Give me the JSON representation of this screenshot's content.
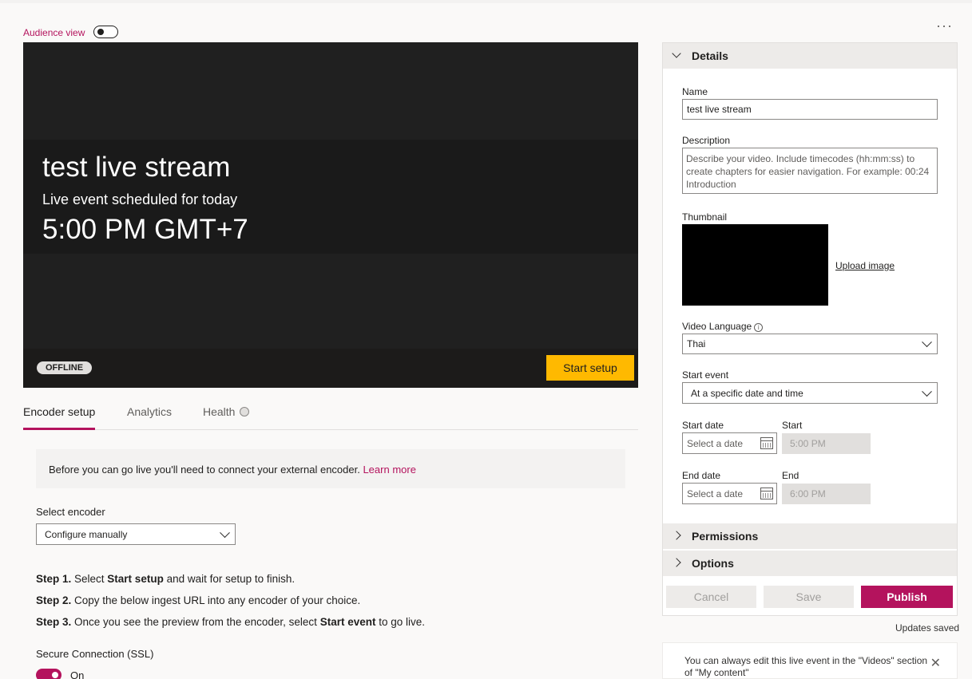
{
  "audience": {
    "label": "Audience view"
  },
  "header": {
    "more": "···"
  },
  "video": {
    "title": "test live stream",
    "scheduled": "Live event scheduled for today",
    "time": "5:00 PM GMT+7",
    "status": "OFFLINE",
    "start_setup": "Start setup"
  },
  "tabs": [
    {
      "label": "Encoder setup"
    },
    {
      "label": "Analytics"
    },
    {
      "label": "Health"
    }
  ],
  "notice": {
    "text": "Before you can go live you'll need to connect your external encoder. ",
    "link": "Learn more"
  },
  "encoder": {
    "label": "Select encoder",
    "value": "Configure manually"
  },
  "steps": [
    {
      "num": "Step 1.",
      "a": " Select ",
      "b": "Start setup",
      "c": " and wait for setup to finish."
    },
    {
      "num": "Step 2.",
      "a": " Copy the below ingest URL into any encoder of your choice.",
      "b": "",
      "c": ""
    },
    {
      "num": "Step 3.",
      "a": " Once you see the preview from the encoder, select ",
      "b": "Start event",
      "c": " to go live."
    }
  ],
  "ssl": {
    "label": "Secure Connection (SSL)",
    "state": "On"
  },
  "details": {
    "header": "Details",
    "name_label": "Name",
    "name_value": "test live stream",
    "desc_label": "Description",
    "desc_placeholder": "Describe your video. Include timecodes (hh:mm:ss) to create chapters for easier navigation. For example: 00:24 Introduction",
    "thumb_label": "Thumbnail",
    "upload": "Upload image",
    "lang_label": "Video Language",
    "info": "i",
    "lang_value": "Thai",
    "start_event_label": "Start event",
    "start_event_value": "At a specific date and time",
    "start_date_label": "Start date",
    "start_label": "Start",
    "start_date_placeholder": "Select a date",
    "start_time": "5:00 PM",
    "end_date_label": "End date",
    "end_label": "End",
    "end_date_placeholder": "Select a date",
    "end_time": "6:00 PM"
  },
  "permissions": {
    "header": "Permissions"
  },
  "options": {
    "header": "Options"
  },
  "actions": {
    "cancel": "Cancel",
    "save": "Save",
    "publish": "Publish"
  },
  "status": {
    "saved": "Updates saved"
  },
  "toast": {
    "text": "You can always edit this live event in the \"Videos\" section of \"My content\"",
    "close": "✕"
  },
  "colors": {
    "accent": "#b4135d",
    "start_setup": "#ffb900"
  }
}
